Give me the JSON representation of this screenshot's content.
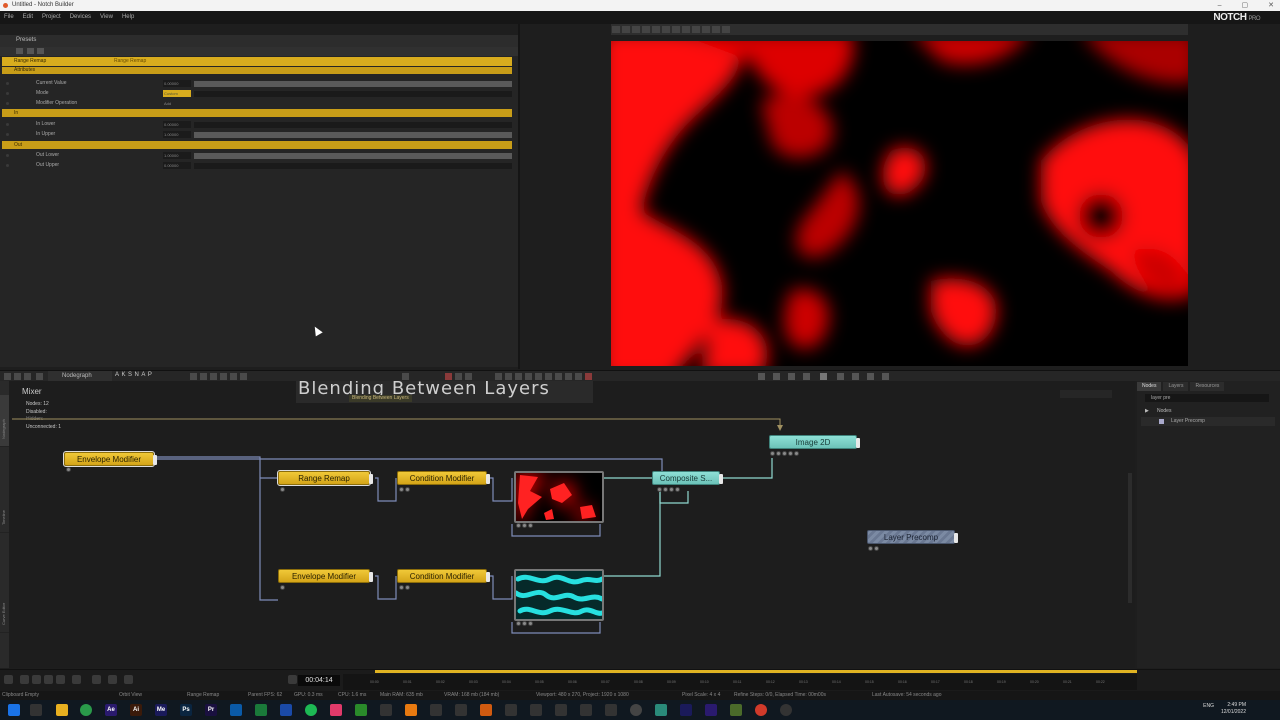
{
  "window": {
    "title": "Untitled - Notch Builder",
    "controls": [
      "–",
      "▢",
      "✕"
    ]
  },
  "menu": [
    "File",
    "Edit",
    "Project",
    "Devices",
    "View",
    "Help"
  ],
  "brand": {
    "name": "NOTCH",
    "edition": "PRO"
  },
  "properties": {
    "header": "Presets",
    "node_name": "Range Remap",
    "node_type": "Range Remap",
    "section_attributes": "Attributes",
    "section_in": "In",
    "section_out": "Out",
    "rows": [
      {
        "label": "Current Value",
        "value": "0.00000"
      },
      {
        "label": "Mode",
        "value": "Custom"
      },
      {
        "label": "Modifier Operation",
        "value": "Add"
      },
      {
        "label": "In Lower",
        "value": "0.00000"
      },
      {
        "label": "In Upper",
        "value": "1.00000"
      },
      {
        "label": "Out Lower",
        "value": "1.00000"
      },
      {
        "label": "Out Upper",
        "value": "0.00000"
      }
    ]
  },
  "nodegraph": {
    "tab": "Nodegraph",
    "toolbar_letters": [
      "A",
      "K",
      "S",
      "N",
      "A",
      "P"
    ],
    "side_tabs": [
      "Nodegraph",
      "Timeline",
      "Curve Editor"
    ],
    "title": "Mixer",
    "stats": {
      "nodes": "Nodes:  12",
      "disabled": "Disabled:",
      "hidden": "Hidden:",
      "unconnected": "Unconnected:  1"
    },
    "comment_title": "Blending  Between  Layers",
    "comment_tag": "Blending  Between  Layers",
    "nodes": {
      "envelope1": "Envelope  Modifier",
      "range_remap": "Range  Remap",
      "condition1": "Condition  Modifier",
      "envelope2": "Envelope  Modifier",
      "condition2": "Condition  Modifier",
      "composite": "Composite  S...",
      "image2d": "Image  2D",
      "layer_precomp": "Layer  Precomp"
    }
  },
  "right_panel": {
    "tabs": [
      "Nodes",
      "Layers",
      "Resources"
    ],
    "search": "layer pre",
    "tree_root": "Nodes",
    "tree_item": "Layer Precomp"
  },
  "timeline": {
    "timecode": "00:04:14",
    "ticks": [
      "00:00",
      "00:01",
      "00:02",
      "00:03",
      "00:04",
      "00:05",
      "00:06",
      "00:07",
      "00:08",
      "00:09",
      "00:10",
      "00:11",
      "00:12",
      "00:13",
      "00:14",
      "00:15",
      "00:16",
      "00:17",
      "00:18",
      "00:19",
      "00:20",
      "00:21",
      "00:22"
    ]
  },
  "status": {
    "clipboard": "Clipboard Empty",
    "orbit": "Orbit View",
    "node": "Range Remap",
    "fps": "Parent FPS: 62",
    "gpu": "GPU: 0.3 ms",
    "cpu": "CPU: 1.6 ms",
    "ram": "Main RAM: 635 mb",
    "vram": "VRAM: 168 mb (184 mb)",
    "viewport": "Viewport: 480 x 270, Project: 1920 x 1080",
    "pixel": "Pixel Scale: 4 x 4",
    "refine": "Refine Steps: 0/0, Elapsed Time: 00m00s",
    "autosave": "Last Autosave: 54 seconds ago"
  },
  "taskbar": {
    "lang": "ENG",
    "time": "2:49 PM",
    "date": "12/01/2022",
    "apps": [
      {
        "label": "Ae",
        "color": "#2a1a6e"
      },
      {
        "label": "Ai",
        "color": "#3a1a0a"
      },
      {
        "label": "Me",
        "color": "#1a1a5a"
      },
      {
        "label": "Ps",
        "color": "#0a2540"
      },
      {
        "label": "Pr",
        "color": "#1a1040"
      }
    ]
  },
  "colors": {
    "accent_yellow": "#d8ac1e",
    "node_cyan": "#7fd4ca",
    "wire": "#7e8cb8"
  }
}
